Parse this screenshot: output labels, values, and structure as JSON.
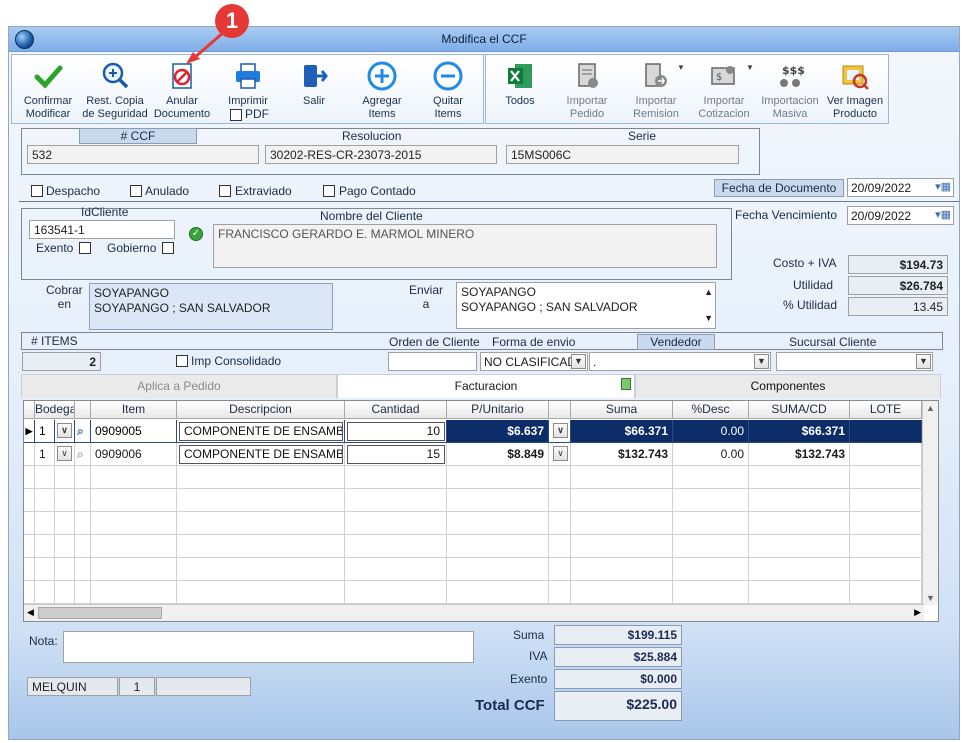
{
  "window": {
    "title": "Modifica el CCF"
  },
  "callout": {
    "number": "1"
  },
  "toolbar": {
    "confirmar": "Confirmar\nModificar",
    "rest_copia": "Rest. Copia\nde Seguridad",
    "anular": "Anular\nDocumento",
    "imprimir": "Imprimir",
    "pdf": "PDF",
    "salir": "Salir",
    "agregar": "Agregar\nItems",
    "quitar": "Quitar\nItems"
  },
  "import_bar": {
    "todos": "Todos",
    "importar_pedido": "Importar\nPedido",
    "importar_remision": "Importar\nRemision",
    "importar_cotizacion": "Importar\nCotizacion",
    "importacion_masiva": "Importacion\nMasiva",
    "ver_imagen": "Ver Imagen\nProducto"
  },
  "doc": {
    "ccf_label": "# CCF",
    "ccf_value": "532",
    "resolucion_label": "Resolucion",
    "resolucion_value": "30202-RES-CR-23073-2015",
    "serie_label": "Serie",
    "serie_value": "15MS006C"
  },
  "flags": {
    "despacho": "Despacho",
    "anulado": "Anulado",
    "extraviado": "Extraviado",
    "pago_contado": "Pago Contado"
  },
  "dates": {
    "fecha_documento_label": "Fecha de  Documento",
    "fecha_documento": "20/09/2022",
    "fecha_vencimiento_label": "Fecha Vencimiento",
    "fecha_vencimiento": "20/09/2022"
  },
  "cliente": {
    "id_label": "IdCliente",
    "id_value": "163541-1",
    "exento": "Exento",
    "gobierno": "Gobierno",
    "nombre_label": "Nombre del Cliente",
    "nombre_value": "FRANCISCO GERARDO E. MARMOL MINERO"
  },
  "costos": {
    "costo_iva_label": "Costo + IVA",
    "costo_iva": "$194.73",
    "utilidad_label": "Utilidad",
    "utilidad": "$26.784",
    "pct_utilidad_label": "% Utilidad",
    "pct_utilidad": "13.45"
  },
  "direcciones": {
    "cobrar_label": "Cobrar\nen",
    "cobrar_l1": "SOYAPANGO",
    "cobrar_l2": "SOYAPANGO ; SAN SALVADOR",
    "enviar_label": "Enviar\na",
    "enviar_l1": "SOYAPANGO",
    "enviar_l2": "SOYAPANGO ; SAN SALVADOR"
  },
  "items_bar": {
    "items_label": "# ITEMS",
    "items_count": "2",
    "imp_consolidado": "Imp Consolidado",
    "orden_cliente_label": "Orden de Cliente",
    "forma_envio_label": "Forma de envio",
    "forma_envio_value": "NO CLASIFICAD",
    "vendedor_label": "Vendedor",
    "vendedor_value": ".",
    "sucursal_label": "Sucursal Cliente"
  },
  "tabs": {
    "aplica": "Aplica a Pedido",
    "facturacion": "Facturacion",
    "componentes": "Componentes"
  },
  "grid": {
    "headers": {
      "bodega": "Bodega",
      "item": "Item",
      "descripcion": "Descripcion",
      "cantidad": "Cantidad",
      "punitario": "P/Unitario",
      "suma": "Suma",
      "desc": "%Desc",
      "sumacd": "SUMA/CD",
      "lote": "LOTE"
    },
    "rows": [
      {
        "bodega": "1",
        "item": "0909005",
        "descripcion": "COMPONENTE DE ENSAMBLE",
        "cantidad": "10",
        "punitario": "$6.637",
        "suma": "$66.371",
        "desc": "0.00",
        "sumacd": "$66.371"
      },
      {
        "bodega": "1",
        "item": "0909006",
        "descripcion": "COMPONENTE DE ENSAMBLE",
        "cantidad": "15",
        "punitario": "$8.849",
        "suma": "$132.743",
        "desc": "0.00",
        "sumacd": "$132.743"
      }
    ]
  },
  "footer": {
    "nota_label": "Nota:",
    "usuario": "MELQUIN",
    "usuario_num": "1",
    "suma_label": "Suma",
    "suma": "$199.115",
    "iva_label": "IVA",
    "iva": "$25.884",
    "exento_label": "Exento",
    "exento": "$0.000",
    "total_label": "Total CCF",
    "total": "$225.00"
  },
  "colors": {
    "accent": "#0b2c66",
    "callout": "#e53935"
  }
}
